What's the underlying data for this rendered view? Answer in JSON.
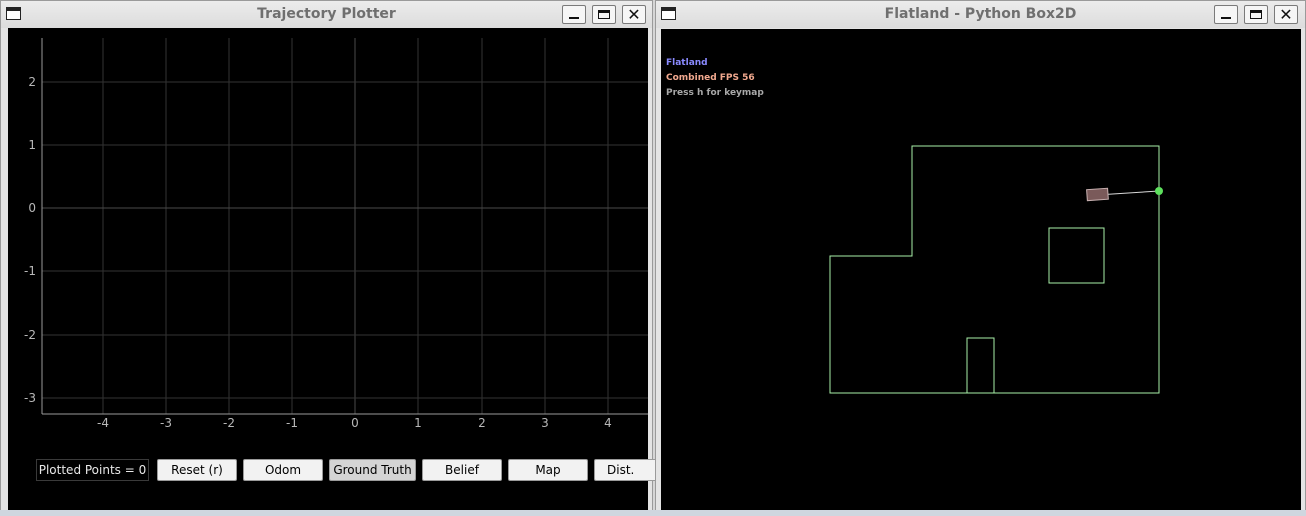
{
  "plotter": {
    "title": "Trajectory Plotter",
    "buttons": {
      "minimize": "",
      "maximize": "",
      "close": "✕"
    },
    "plot": {
      "x_ticks": [
        "-4",
        "-3",
        "-2",
        "-1",
        "0",
        "1",
        "2",
        "3",
        "4"
      ],
      "y_ticks": [
        "2",
        "1",
        "0",
        "-1",
        "-2",
        "-3"
      ]
    },
    "controls": {
      "points_label": "Plotted Points = 0",
      "reset": "Reset (r)",
      "odom": "Odom",
      "ground_truth": "Ground Truth",
      "belief": "Belief",
      "map": "Map",
      "dist": "Dist."
    }
  },
  "flatland": {
    "title": "Flatland - Python Box2D",
    "hud": {
      "name": "Flatland",
      "fps": "Combined FPS 56",
      "hint": "Press h for keymap"
    },
    "colors": {
      "name": "#8a8aff",
      "fps": "#f2a98f",
      "hint": "#a8a8a8",
      "walls": "#a8f0a8",
      "robot": "#7a5a5a",
      "target": "#5de05d"
    }
  }
}
